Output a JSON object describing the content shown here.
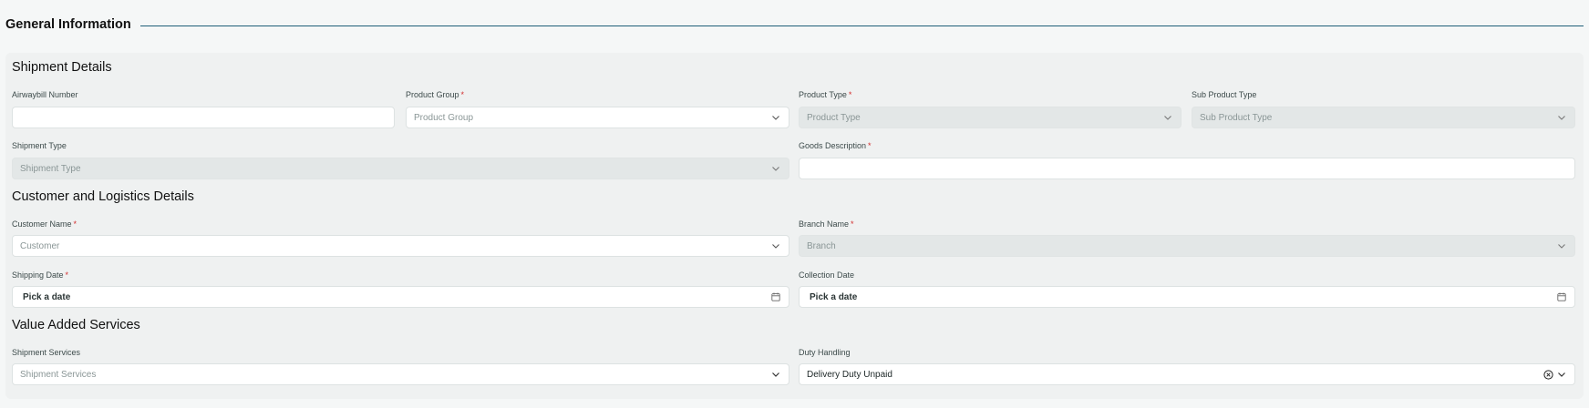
{
  "section": {
    "title": "General Information"
  },
  "shipment_details": {
    "heading": "Shipment Details",
    "airwaybill": {
      "label": "Airwaybill Number",
      "value": ""
    },
    "product_group": {
      "label": "Product Group",
      "placeholder": "Product Group"
    },
    "product_type": {
      "label": "Product Type",
      "placeholder": "Product Type"
    },
    "sub_product_type": {
      "label": "Sub Product Type",
      "placeholder": "Sub Product Type"
    },
    "shipment_type": {
      "label": "Shipment Type",
      "placeholder": "Shipment Type"
    },
    "goods_description": {
      "label": "Goods Description",
      "value": ""
    }
  },
  "customer_details": {
    "heading": "Customer and Logistics Details",
    "customer_name": {
      "label": "Customer Name",
      "placeholder": "Customer"
    },
    "branch_name": {
      "label": "Branch Name",
      "placeholder": "Branch"
    },
    "shipping_date": {
      "label": "Shipping Date",
      "value": "Pick a date"
    },
    "collection_date": {
      "label": "Collection Date",
      "value": "Pick a date"
    }
  },
  "value_added": {
    "heading": "Value Added Services",
    "shipment_services": {
      "label": "Shipment Services",
      "placeholder": "Shipment Services"
    },
    "duty_handling": {
      "label": "Duty Handling",
      "value": "Delivery Duty Unpaid"
    }
  },
  "required_marker": "*",
  "colors": {
    "accent_rule": "#1f5f78",
    "required": "#d32f2f",
    "disabled_bg": "#e3e7e7"
  },
  "icons": [
    "chevron-down-icon",
    "calendar-icon",
    "clear-icon"
  ]
}
